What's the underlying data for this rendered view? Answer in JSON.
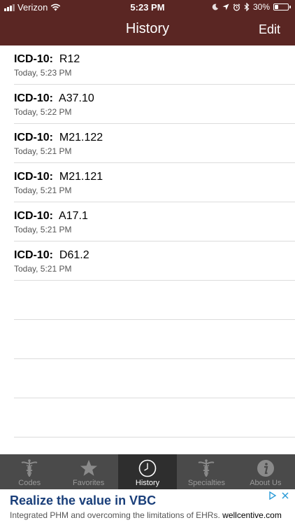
{
  "status_bar": {
    "carrier": "Verizon",
    "time": "5:23 PM",
    "battery": "30%",
    "battery_level": 0.3,
    "icons": [
      "signal-icon",
      "wifi-icon",
      "moon-icon",
      "location-icon",
      "alarm-icon",
      "bluetooth-icon",
      "battery-icon"
    ]
  },
  "nav": {
    "title": "History",
    "edit_label": "Edit"
  },
  "history": {
    "items": [
      {
        "label": "ICD-10:",
        "code": "R12",
        "time": "Today, 5:23 PM"
      },
      {
        "label": "ICD-10:",
        "code": "A37.10",
        "time": "Today, 5:22 PM"
      },
      {
        "label": "ICD-10:",
        "code": "M21.122",
        "time": "Today, 5:21 PM"
      },
      {
        "label": "ICD-10:",
        "code": "M21.121",
        "time": "Today, 5:21 PM"
      },
      {
        "label": "ICD-10:",
        "code": "A17.1",
        "time": "Today, 5:21 PM"
      },
      {
        "label": "ICD-10:",
        "code": "D61.2",
        "time": "Today, 5:21 PM"
      }
    ]
  },
  "tabs": [
    {
      "label": "Codes",
      "icon": "caduceus-icon",
      "active": false
    },
    {
      "label": "Favorites",
      "icon": "star-icon",
      "active": false
    },
    {
      "label": "History",
      "icon": "clock-icon",
      "active": true
    },
    {
      "label": "Specialties",
      "icon": "caduceus-icon",
      "active": false
    },
    {
      "label": "About Us",
      "icon": "info-icon",
      "active": false
    }
  ],
  "ad": {
    "title": "Realize the value in VBC",
    "subtitle": "Integrated PHM and overcoming the limitations of EHRs.",
    "host": "wellcentive.com",
    "icons": [
      "adchoices-icon",
      "close-icon"
    ]
  },
  "colors": {
    "header_bg": "#5a2623",
    "tabbar_bg": "#4a4a4a",
    "tab_active_bg": "#2e2e2e",
    "ad_title": "#1a3f7a"
  }
}
